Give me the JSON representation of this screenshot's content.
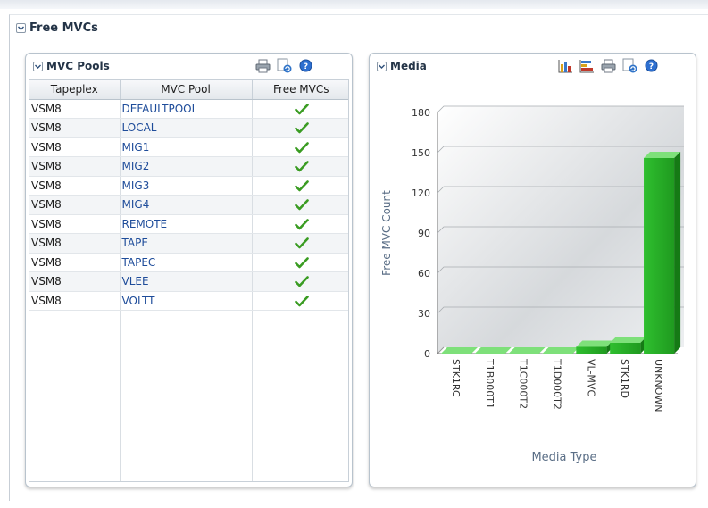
{
  "section": {
    "title": "Free MVCs"
  },
  "pools_panel": {
    "title": "MVC Pools",
    "toolbar": [
      {
        "name": "print-icon",
        "label": "Print"
      },
      {
        "name": "refresh-icon",
        "label": "Refresh"
      },
      {
        "name": "help-icon",
        "label": "Help"
      }
    ],
    "columns": [
      "Tapeplex",
      "MVC Pool",
      "Free MVCs"
    ],
    "rows": [
      {
        "tapeplex": "VSM8",
        "pool": "DEFAULTPOOL",
        "free": "check-icon"
      },
      {
        "tapeplex": "VSM8",
        "pool": "LOCAL",
        "free": "check-icon"
      },
      {
        "tapeplex": "VSM8",
        "pool": "MIG1",
        "free": "check-icon"
      },
      {
        "tapeplex": "VSM8",
        "pool": "MIG2",
        "free": "check-icon"
      },
      {
        "tapeplex": "VSM8",
        "pool": "MIG3",
        "free": "check-icon"
      },
      {
        "tapeplex": "VSM8",
        "pool": "MIG4",
        "free": "check-icon"
      },
      {
        "tapeplex": "VSM8",
        "pool": "REMOTE",
        "free": "check-icon"
      },
      {
        "tapeplex": "VSM8",
        "pool": "TAPE",
        "free": "check-icon"
      },
      {
        "tapeplex": "VSM8",
        "pool": "TAPEC",
        "free": "check-icon"
      },
      {
        "tapeplex": "VSM8",
        "pool": "VLEE",
        "free": "check-icon"
      },
      {
        "tapeplex": "VSM8",
        "pool": "VOLTT",
        "free": "check-icon"
      }
    ]
  },
  "media_panel": {
    "title": "Media",
    "toolbar": [
      {
        "name": "vertical-bar-chart-icon",
        "label": "Vertical Bar Chart"
      },
      {
        "name": "horizontal-bar-chart-icon",
        "label": "Horizontal Bar Chart"
      },
      {
        "name": "print-icon",
        "label": "Print"
      },
      {
        "name": "refresh-icon",
        "label": "Refresh"
      },
      {
        "name": "help-icon",
        "label": "Help"
      }
    ]
  },
  "colors": {
    "bar": "#2db32d",
    "link": "#1e4c9a",
    "check": "#3a9c22"
  },
  "chart_data": {
    "type": "bar",
    "categories": [
      "STK1RC",
      "T1B000T1",
      "T1C000T2",
      "T1D000T2",
      "VL-MVC",
      "STK1RD",
      "UNKNOWN"
    ],
    "values": [
      0,
      0,
      0,
      0,
      5,
      8,
      146
    ],
    "xlabel": "Media Type",
    "ylabel": "Free MVC Count",
    "ylim": [
      0,
      180
    ],
    "yticks": [
      0,
      30,
      60,
      90,
      120,
      150,
      180
    ],
    "grid": true,
    "style": "3d"
  }
}
